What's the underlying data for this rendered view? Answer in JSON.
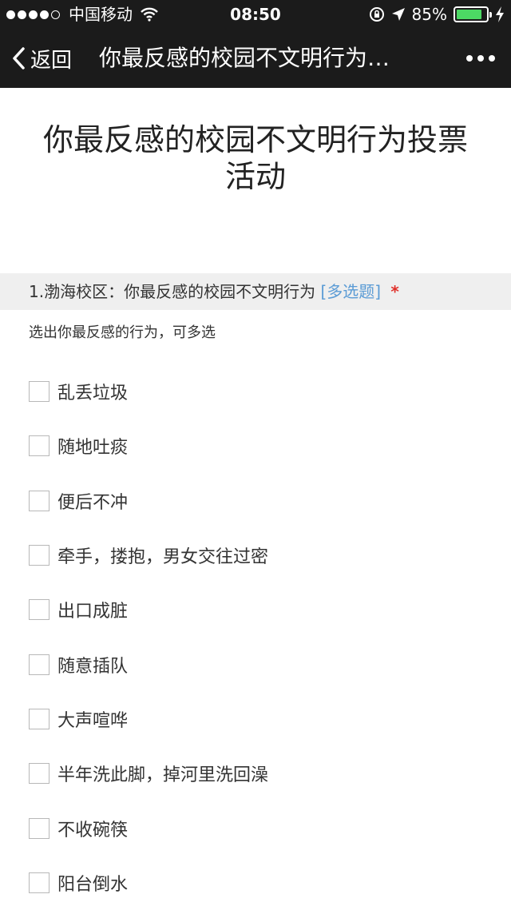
{
  "status_bar": {
    "carrier": "中国移动",
    "time": "08:50",
    "battery": "85%",
    "battery_level": 0.85
  },
  "nav": {
    "back_label": "返回",
    "title": "你最反感的校园不文明行为…"
  },
  "survey": {
    "title": "你最反感的校园不文明行为投票活动",
    "question": {
      "text": "1.渤海校区：你最反感的校园不文明行为",
      "type_label": "[多选题]",
      "required_mark": "*",
      "hint": "选出你最反感的行为，可多选",
      "options": [
        "乱丢垃圾",
        "随地吐痰",
        "便后不冲",
        "牵手，搂抱，男女交往过密",
        "出口成脏",
        "随意插队",
        "大声喧哗",
        "半年洗此脚，掉河里洗回澡",
        "不收碗筷",
        "阳台倒水"
      ]
    }
  },
  "colors": {
    "bar_background": "#1b1b1b",
    "type_label": "#5a9bd5",
    "required": "#e0302a",
    "battery": "#4cd964"
  }
}
